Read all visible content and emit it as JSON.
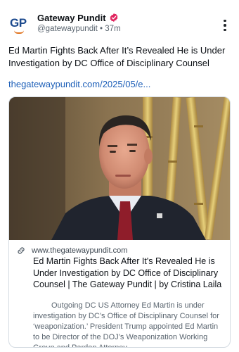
{
  "author": {
    "display_name": "Gateway Pundit",
    "handle": "@gatewaypundit",
    "time_ago": "37m",
    "separator": "•",
    "avatar_text": "GP",
    "verified_color": "#e0245e"
  },
  "post": {
    "text": "Ed Martin Fights Back After It’s Revealed He is Under Investigation by DC Office of Disciplinary Counsel",
    "link_text": "thegatewaypundit.com/2025/05/e..."
  },
  "link_card": {
    "domain": "www.thegatewaypundit.com",
    "title": "Ed Martin Fights Back After It's Revealed He is Under Investigation by DC Office of Disciplinary Counsel | The Gateway Pundit | by Cristina Laila",
    "description": "Outgoing DC US Attorney Ed Martin is under investigation by DC’s Office of Disciplinary Counsel for ‘weaponization.’ President Trump appointed Ed Martin to be Director of the DOJ’s Weaponization Working Group and Pardon Attorney."
  },
  "icons": {
    "verified": "verified-badge-icon",
    "more": "more-options-icon",
    "link": "link-icon"
  },
  "colors": {
    "link": "#1d5fb8",
    "brand_blue": "#1c4a8e",
    "brand_orange": "#e0731f"
  }
}
